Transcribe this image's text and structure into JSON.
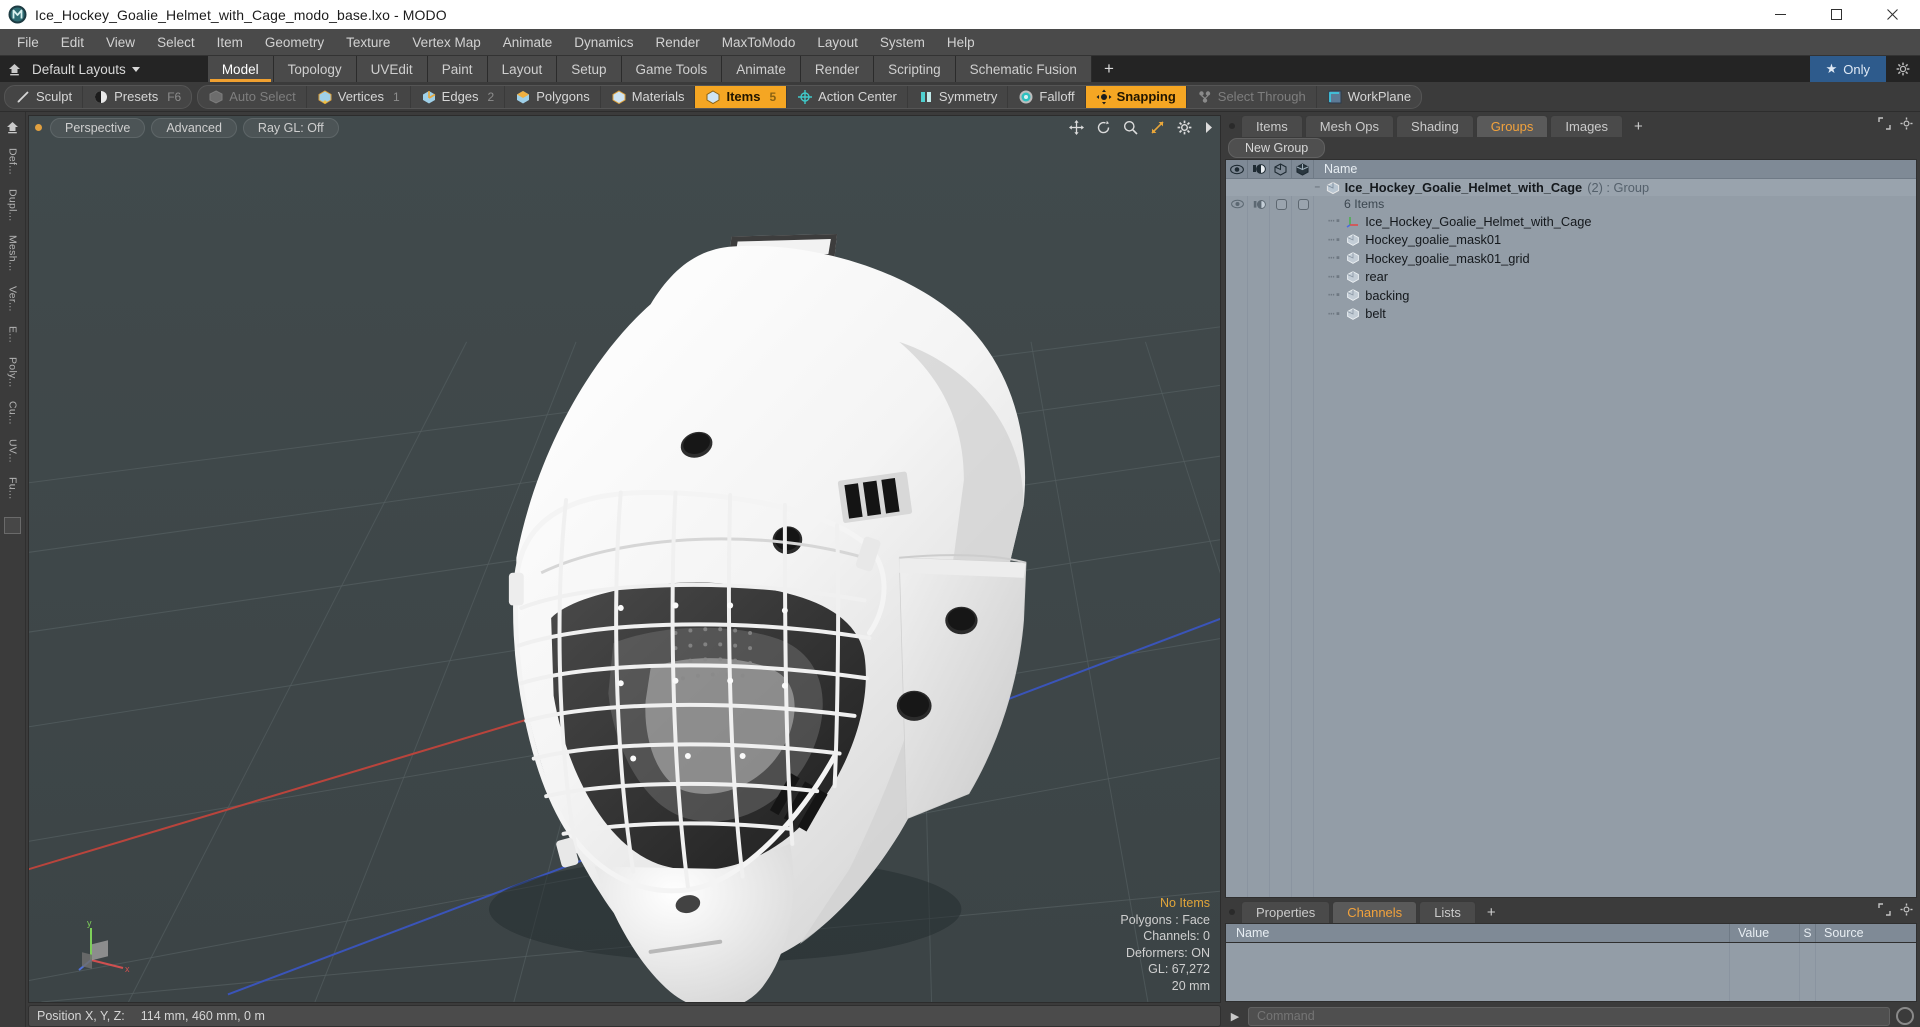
{
  "window": {
    "title": "Ice_Hockey_Goalie_Helmet_with_Cage_modo_base.lxo - MODO",
    "app_icon": "modo-logo-icon",
    "minimize": "─",
    "maximize": "☐",
    "close": "✕"
  },
  "menubar": {
    "items": [
      "File",
      "Edit",
      "View",
      "Select",
      "Item",
      "Geometry",
      "Texture",
      "Vertex Map",
      "Animate",
      "Dynamics",
      "Render",
      "MaxToModo",
      "Layout",
      "System",
      "Help"
    ]
  },
  "layoutbar": {
    "home_icon": "home-up-icon",
    "layouts_label": "Default Layouts",
    "tabs": [
      {
        "label": "Model",
        "active": true
      },
      {
        "label": "Topology",
        "active": false
      },
      {
        "label": "UVEdit",
        "active": false
      },
      {
        "label": "Paint",
        "active": false
      },
      {
        "label": "Layout",
        "active": false
      },
      {
        "label": "Setup",
        "active": false
      },
      {
        "label": "Game Tools",
        "active": false
      },
      {
        "label": "Animate",
        "active": false
      },
      {
        "label": "Render",
        "active": false
      },
      {
        "label": "Scripting",
        "active": false
      },
      {
        "label": "Schematic Fusion",
        "active": false
      }
    ],
    "add_tab": "+",
    "only_label": "Only",
    "only_star": "★",
    "gear_icon": "gear-icon",
    "accent": "#f0a030",
    "only_bg": "#2e5b8c"
  },
  "toolstrip": {
    "groups": [
      {
        "buttons": [
          {
            "label": "Sculpt",
            "icon": "sculpt-brush-icon",
            "state": "normal",
            "num": ""
          },
          {
            "label": "Presets",
            "icon": "presets-sphere-icon",
            "state": "normal",
            "num": "F6"
          }
        ]
      },
      {
        "buttons": [
          {
            "label": "Auto Select",
            "icon": "auto-select-icon",
            "state": "disabled",
            "num": ""
          },
          {
            "label": "Vertices",
            "icon": "vertices-icon",
            "state": "normal",
            "num": "1"
          },
          {
            "label": "Edges",
            "icon": "edges-icon",
            "state": "normal",
            "num": "2"
          },
          {
            "label": "Polygons",
            "icon": "polygons-icon",
            "state": "normal",
            "num": ""
          },
          {
            "label": "Materials",
            "icon": "materials-icon",
            "state": "normal",
            "num": ""
          },
          {
            "label": "Items",
            "icon": "items-icon",
            "state": "active",
            "num": "5"
          },
          {
            "label": "Action Center",
            "icon": "action-center-icon",
            "state": "normal",
            "num": ""
          },
          {
            "label": "Symmetry",
            "icon": "symmetry-icon",
            "state": "normal",
            "num": ""
          },
          {
            "label": "Falloff",
            "icon": "falloff-icon",
            "state": "normal",
            "num": ""
          },
          {
            "label": "Snapping",
            "icon": "snapping-icon",
            "state": "active",
            "num": ""
          },
          {
            "label": "Select Through",
            "icon": "select-through-icon",
            "state": "disabled",
            "num": ""
          },
          {
            "label": "WorkPlane",
            "icon": "workplane-icon",
            "state": "normal",
            "num": ""
          }
        ]
      }
    ]
  },
  "leftrail": {
    "items": [
      "Def...",
      "Dupl...",
      "Mesh...",
      "Ver...",
      "E...",
      "Poly...",
      "Cu...",
      "UV...",
      "Fu..."
    ]
  },
  "viewport": {
    "pills": [
      "Perspective",
      "Advanced",
      "Ray GL: Off"
    ],
    "tool_icons": [
      "move-icon",
      "rotate-icon",
      "zoom-icon",
      "fit-icon",
      "gear-icon",
      "expand-arrow-icon"
    ],
    "stats": {
      "no_items": "No Items",
      "polygons": "Polygons : Face",
      "channels": "Channels: 0",
      "deformers": "Deformers: ON",
      "gl": "GL: 67,272",
      "grid": "20 mm"
    },
    "axis": {
      "x": "x",
      "y": "y",
      "z": "z"
    },
    "model_name": "ice-hockey-goalie-helmet-with-cage"
  },
  "statusbar": {
    "position_label": "Position X, Y, Z:",
    "position_value": "114 mm, 460 mm, 0 m"
  },
  "rightpanel": {
    "tabs": [
      {
        "label": "Items",
        "active": false
      },
      {
        "label": "Mesh Ops",
        "active": false
      },
      {
        "label": "Shading",
        "active": false
      },
      {
        "label": "Groups",
        "active": true
      },
      {
        "label": "Images",
        "active": false
      }
    ],
    "add_tab": "+",
    "new_group_label": "New Group",
    "tree_columns": {
      "eye_icon": "visibility-eye-icon",
      "render_icon": "render-shading-icon",
      "lock_icon": "lock-cube-icon",
      "wire_icon": "wireframe-cube-icon",
      "name": "Name"
    },
    "tree": [
      {
        "name": "Ice_Hockey_Goalie_Helmet_with_Cage",
        "meta": "(2) : Group",
        "type": "group",
        "icon": "group-cube-icon",
        "selected": true,
        "count_label": "6 Items",
        "children": [
          {
            "name": "Ice_Hockey_Goalie_Helmet_with_Cage",
            "icon": "locator-axis-icon"
          },
          {
            "name": "Hockey_goalie_mask01",
            "icon": "mesh-cube-icon"
          },
          {
            "name": "Hockey_goalie_mask01_grid",
            "icon": "mesh-cube-icon"
          },
          {
            "name": "rear",
            "icon": "mesh-cube-icon"
          },
          {
            "name": "backing",
            "icon": "mesh-cube-icon"
          },
          {
            "name": "belt",
            "icon": "mesh-cube-icon"
          }
        ]
      }
    ],
    "bottom_tabs": [
      {
        "label": "Properties",
        "active": false
      },
      {
        "label": "Channels",
        "active": true
      },
      {
        "label": "Lists",
        "active": false
      }
    ],
    "bottom_add_tab": "+",
    "channel_columns": [
      "Name",
      "Value",
      "S",
      "Source"
    ]
  },
  "command": {
    "placeholder": "Command",
    "arrow": "▶",
    "record_icon": "record-icon"
  }
}
